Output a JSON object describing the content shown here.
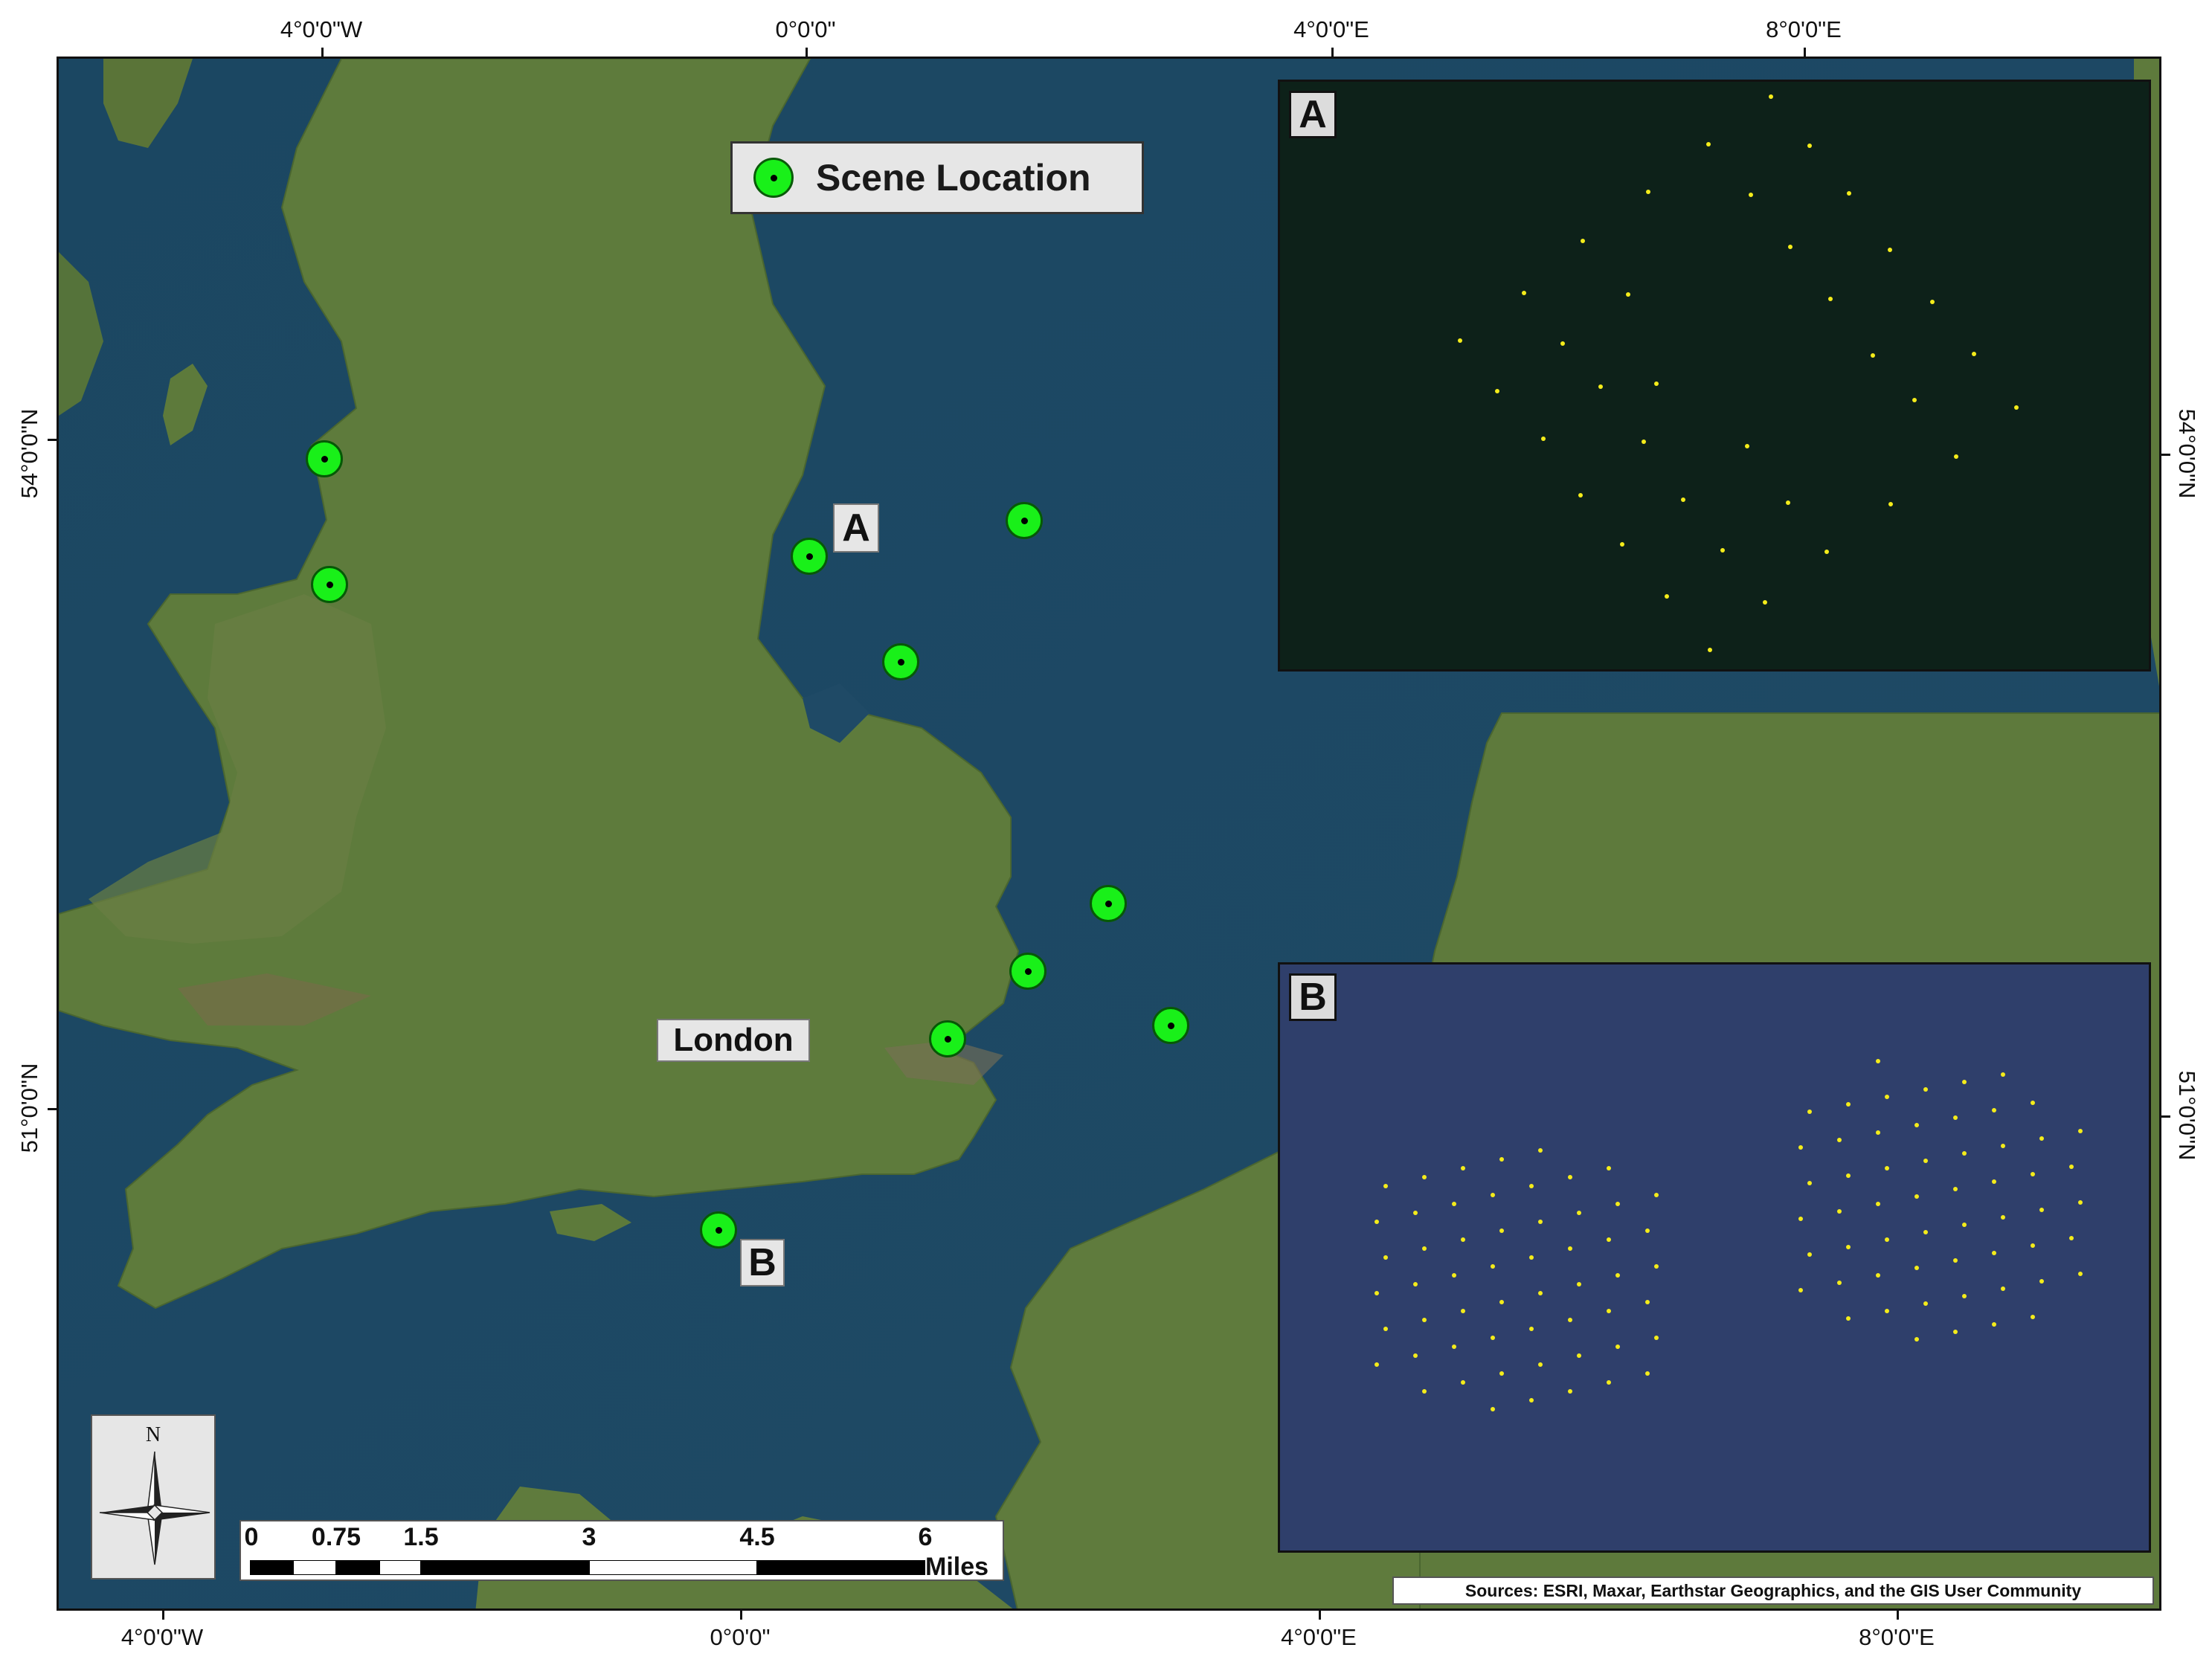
{
  "axis": {
    "top_labels": [
      "4°0'0\"W",
      "0°0'0\"",
      "4°0'0\"E",
      "8°0'0\"E"
    ],
    "bottom_labels": [
      "4°0'0\"W",
      "0°0'0\"",
      "4°0'0\"E",
      "8°0'0\"E"
    ],
    "left_labels": [
      "54°0'0\"N",
      "51°0'0\"N"
    ],
    "right_labels": [
      "54°0'0\"N",
      "51°0'0\"N"
    ]
  },
  "legend": {
    "label": "Scene Location",
    "color": "#19f019"
  },
  "labels": {
    "a": "A",
    "b": "B",
    "london": "London"
  },
  "insets": {
    "a_letter": "A",
    "b_letter": "B",
    "turbine_color": "#f4ec1a"
  },
  "north_arrow": {
    "letter": "N"
  },
  "scale_bar": {
    "ticks": [
      "0",
      "0.75",
      "1.5",
      "3",
      "4.5",
      "6"
    ],
    "unit": "Miles"
  },
  "sources": "Sources: ESRI, Maxar, Earthstar Geographics, and the GIS User Community",
  "colors": {
    "sea": "#1e4a63",
    "land": "#5b7a3a"
  }
}
